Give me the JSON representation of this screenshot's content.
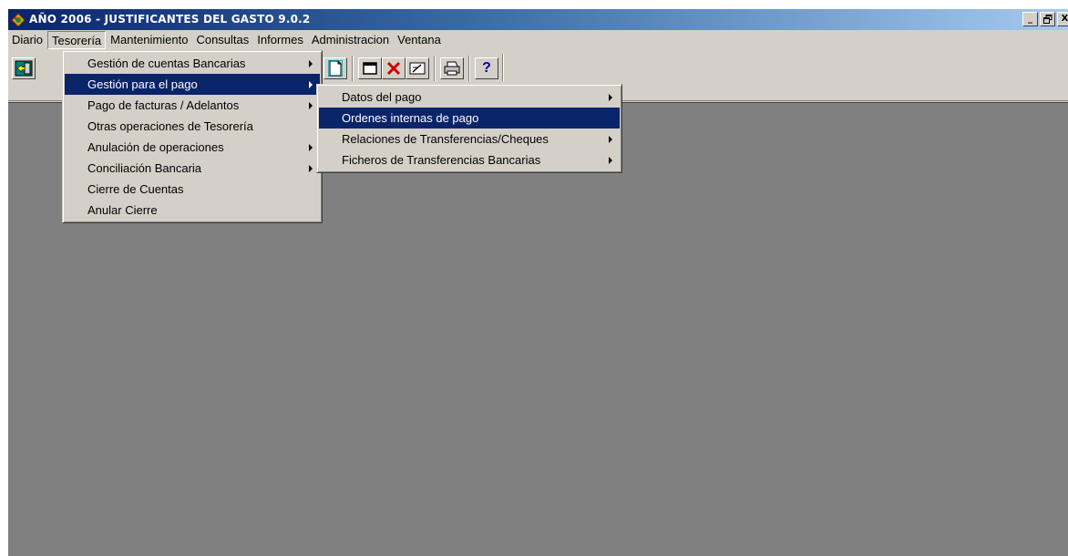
{
  "window": {
    "title": "AÑO 2006 - JUSTIFICANTES DEL GASTO 9.0.2",
    "minimize": "_",
    "restore": "🗗",
    "close": "X"
  },
  "menubar": {
    "items": [
      {
        "label": "Diario"
      },
      {
        "label": "Tesorería"
      },
      {
        "label": "Mantenimiento"
      },
      {
        "label": "Consultas"
      },
      {
        "label": "Informes"
      },
      {
        "label": "Administracion"
      },
      {
        "label": "Ventana"
      }
    ]
  },
  "tesoreria_menu": {
    "items": [
      {
        "label": "Gestión de cuentas Bancarias",
        "submenu": true
      },
      {
        "label": "Gestión para el pago",
        "submenu": true
      },
      {
        "label": "Pago de facturas / Adelantos",
        "submenu": true
      },
      {
        "label": "Otras operaciones de Tesorería",
        "submenu": false
      },
      {
        "label": "Anulación de operaciones",
        "submenu": true
      },
      {
        "label": "Conciliación Bancaria",
        "submenu": true
      },
      {
        "label": "Cierre de Cuentas",
        "submenu": false
      },
      {
        "label": "Anular Cierre",
        "submenu": false
      }
    ]
  },
  "pago_submenu": {
    "items": [
      {
        "label": "Datos del pago",
        "submenu": true
      },
      {
        "label": "Ordenes internas de pago",
        "submenu": false
      },
      {
        "label": "Relaciones de Transferencias/Cheques",
        "submenu": true
      },
      {
        "label": "Ficheros de Transferencias Bancarias",
        "submenu": true
      }
    ]
  },
  "toolbar": {
    "help_label": "?"
  },
  "colors": {
    "title_start": "#0a246a",
    "title_end": "#a6caf0",
    "selection": "#0a246a",
    "workspace": "#808080",
    "face": "#d4d0c8"
  }
}
